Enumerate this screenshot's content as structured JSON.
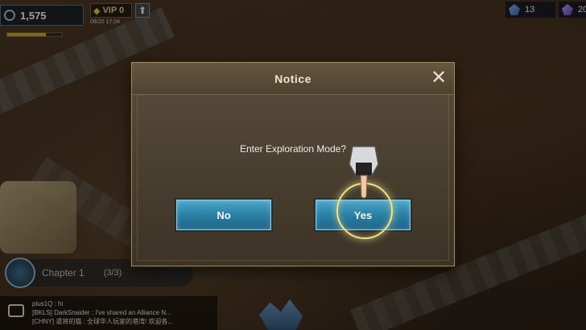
{
  "hud": {
    "power_value": "1,575",
    "vip_label": "VIP 0",
    "timestamp": "09/20 17:04",
    "power_icon": "power-icon",
    "upgrade_icon": "up-arrow-icon"
  },
  "resources": {
    "gems": "13",
    "crystals": "20"
  },
  "chapter": {
    "label": "Chapter 1",
    "progress": "(3/3)"
  },
  "chat": {
    "line1": "plus1Q : hi",
    "line2": "[BKLS] DarkSnaider : I've shared an Alliance N...",
    "line3": "[CHNY] 遣将的猫 : 全球华人玩家的港湾! 欢迎各..."
  },
  "modal": {
    "title": "Notice",
    "message": "Enter Exploration Mode?",
    "no_label": "No",
    "yes_label": "Yes",
    "close_icon": "close-icon"
  },
  "colors": {
    "button_blue": "#2a7fa5",
    "frame_gold": "#a48b55",
    "highlight_ring": "#f3e28a"
  }
}
